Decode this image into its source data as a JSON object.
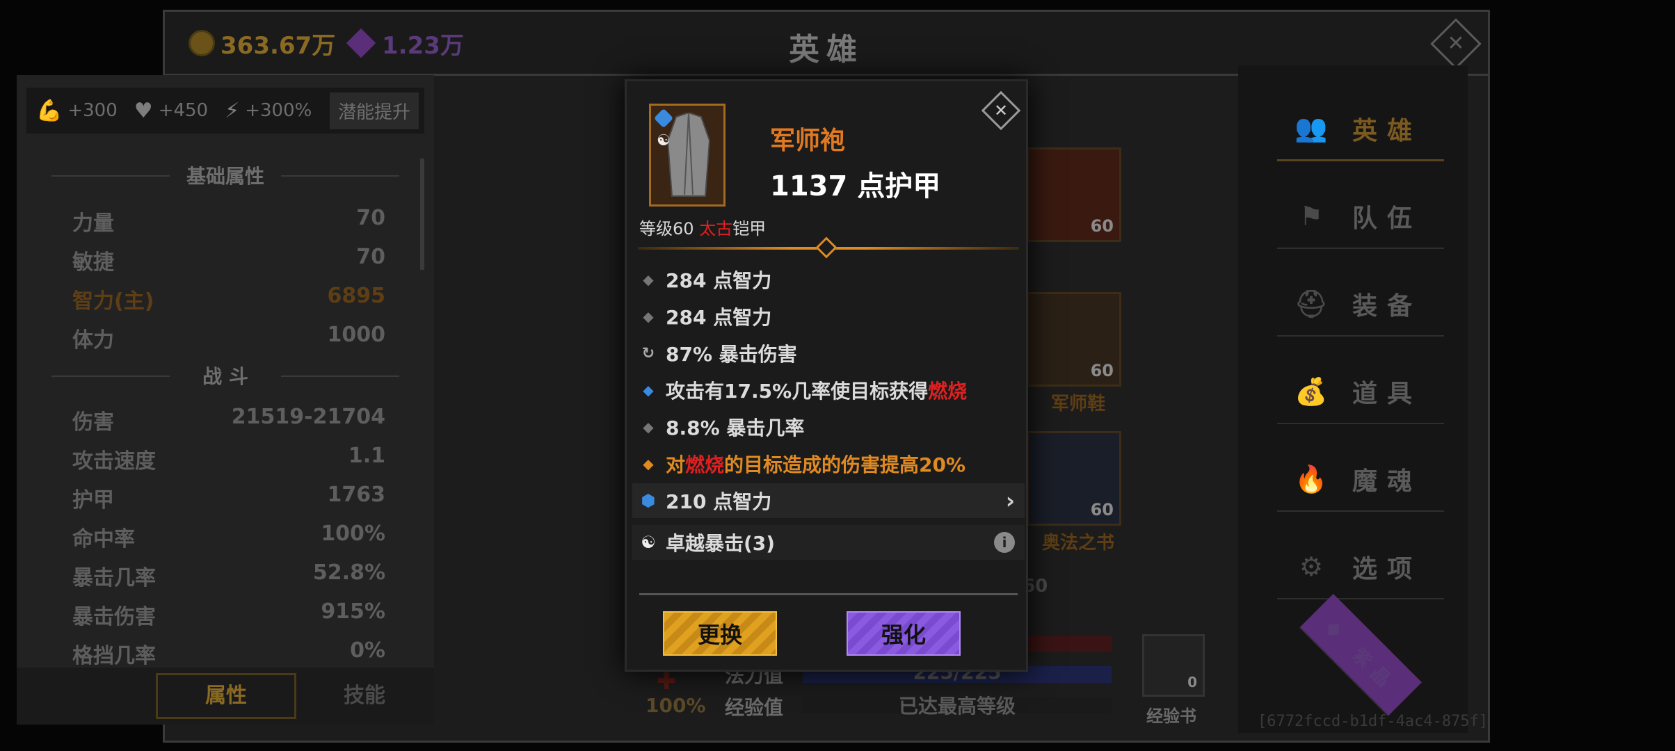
{
  "currency": {
    "gold": "363.67万",
    "gems": "1.23万"
  },
  "window": {
    "title": "英雄"
  },
  "potential": {
    "str_bonus": "+300",
    "hp_bonus": "+450",
    "speed_bonus": "+300%",
    "button": "潜能提升"
  },
  "sections": {
    "basic": "基础属性",
    "combat": "战 斗"
  },
  "basic_attrs": [
    {
      "name": "力量",
      "value": "70"
    },
    {
      "name": "敏捷",
      "value": "70"
    },
    {
      "name": "智力(主)",
      "value": "6895"
    },
    {
      "name": "体力",
      "value": "1000"
    }
  ],
  "combat_attrs": [
    {
      "name": "伤害",
      "value": "21519-21704"
    },
    {
      "name": "攻击速度",
      "value": "1.1"
    },
    {
      "name": "护甲",
      "value": "1763"
    },
    {
      "name": "命中率",
      "value": "100%"
    },
    {
      "name": "暴击几率",
      "value": "52.8%"
    },
    {
      "name": "暴击伤害",
      "value": "915%"
    },
    {
      "name": "格挡几率",
      "value": "0%"
    }
  ],
  "left_tabs": {
    "attrs": "属性",
    "skills": "技能"
  },
  "equipment": [
    {
      "level": "60",
      "name": ""
    },
    {
      "level": "60",
      "name": "军师鞋"
    },
    {
      "level": "60",
      "name": "奥法之书"
    }
  ],
  "hero_level_partial": "60",
  "bars": {
    "mana_label": "法力值",
    "mana_value": "225/225",
    "exp_label": "经验值",
    "exp_value": "已达最高等级",
    "crit_pct": "100%",
    "exp_book_label": "经验书",
    "exp_book_count": "0"
  },
  "nav": [
    {
      "label": "英雄",
      "icon": "heroes-icon",
      "glyph": "👥"
    },
    {
      "label": "队伍",
      "icon": "flag-icon",
      "glyph": "⚑"
    },
    {
      "label": "装备",
      "icon": "helmet-icon",
      "glyph": "⛑"
    },
    {
      "label": "道具",
      "icon": "bag-icon",
      "glyph": "💰"
    },
    {
      "label": "魔魂",
      "icon": "flame-icon",
      "glyph": "🔥"
    },
    {
      "label": "选项",
      "icon": "gear-icon",
      "glyph": "⚙"
    },
    {
      "label": "紫晶",
      "icon": "gem-icon",
      "glyph": "◆"
    }
  ],
  "id_text": "[6772fccd-b1df-4ac4-875f]",
  "item": {
    "name": "军师袍",
    "armor": "1137 点护甲",
    "level_text": "等级60",
    "quality": "太古",
    "type": "铠甲",
    "affixes": [
      {
        "text": "284 点智力"
      },
      {
        "text": "284 点智力"
      },
      {
        "text": "87% 暴击伤害"
      },
      {
        "pre": "攻击有17.5%几率使目标获得",
        "hl": "燃烧"
      },
      {
        "text": "8.8% 暴击几率"
      },
      {
        "pre": "对",
        "hl": "燃烧",
        "post": "的目标造成的伤害提高20%"
      }
    ],
    "gem": "210 点智力",
    "set": "卓越暴击(3)",
    "btn_swap": "更换",
    "btn_enhance": "强化"
  },
  "colors": {
    "legendary": "#e07a22",
    "ancient": "#e02020",
    "swap_button": "#e0a020",
    "enhance_button": "#8a5ae0"
  }
}
